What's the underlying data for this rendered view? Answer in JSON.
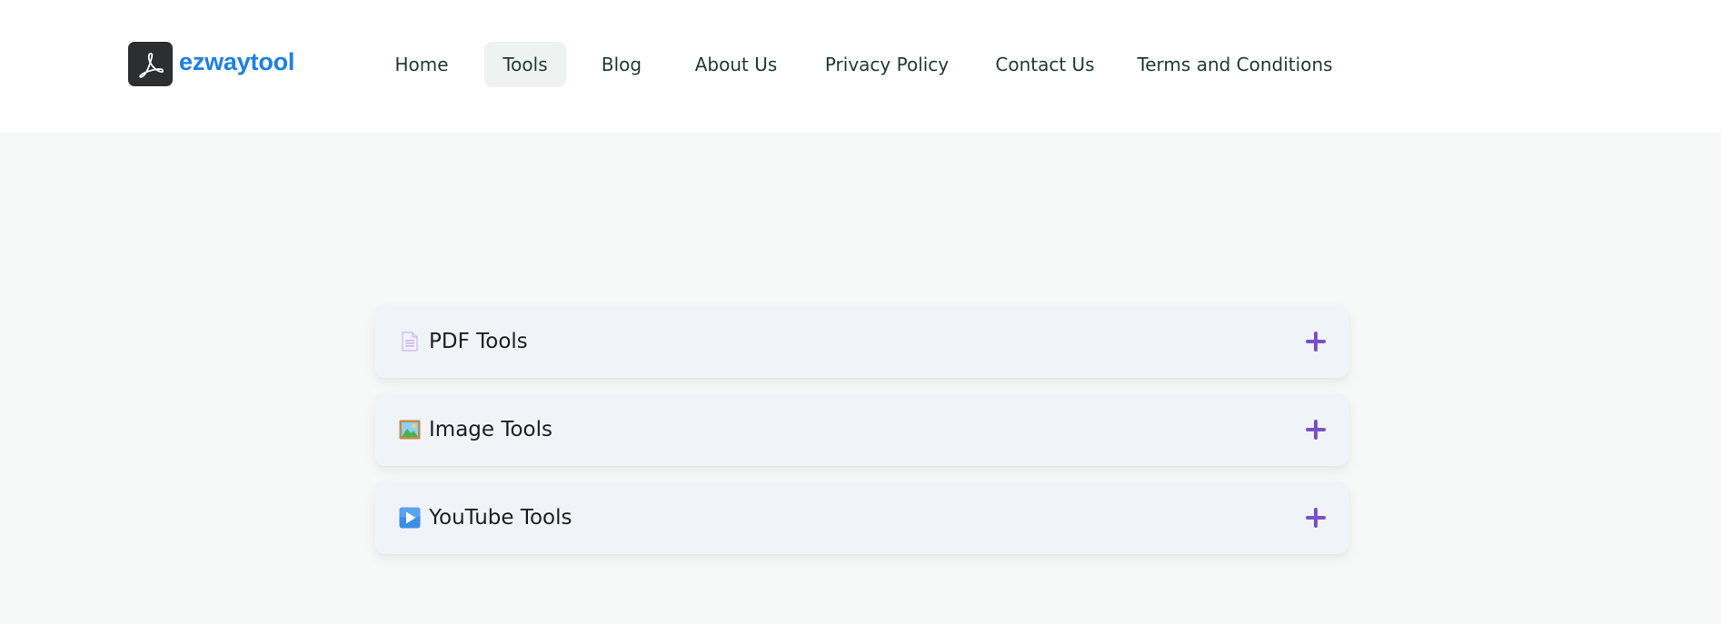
{
  "brand": {
    "name": "ezwaytool",
    "icon": "acrobat-logo-icon",
    "color": "#1d7fe6"
  },
  "nav": {
    "items": [
      {
        "label": "Home",
        "active": false
      },
      {
        "label": "Tools",
        "active": true
      },
      {
        "label": "Blog",
        "active": false
      },
      {
        "label": "About Us",
        "active": false
      },
      {
        "label": "Privacy Policy",
        "active": false
      },
      {
        "label": "Contact Us",
        "active": false
      },
      {
        "label": "Terms and Conditions",
        "active": false
      }
    ]
  },
  "sections": [
    {
      "icon": "page-document-icon",
      "title": "PDF Tools",
      "expanded": false
    },
    {
      "icon": "framed-picture-icon",
      "title": "Image Tools",
      "expanded": false
    },
    {
      "icon": "play-button-icon",
      "title": "YouTube Tools",
      "expanded": false
    }
  ],
  "colors": {
    "accent": "#7a52c7",
    "nav_text": "#1f3a34",
    "header_bg": "#ffffff",
    "page_bg": "#f7f8f8",
    "card_bg": "#f0f3f8"
  }
}
